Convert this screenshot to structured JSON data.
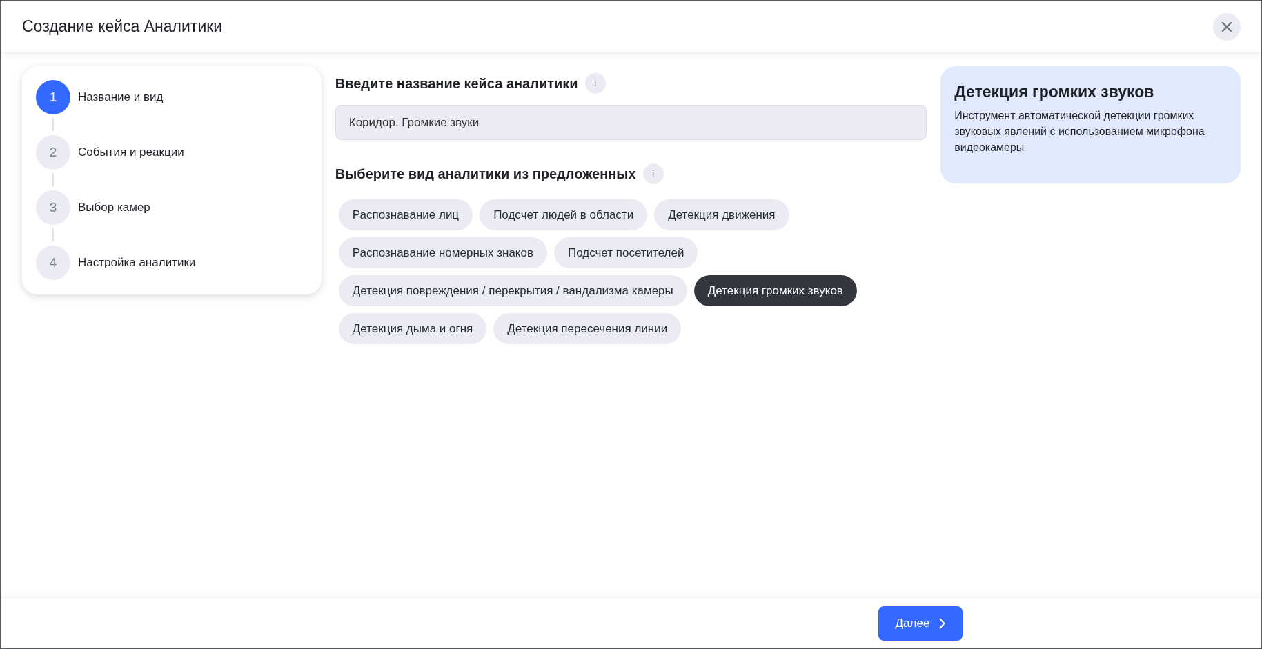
{
  "window": {
    "title": "Создание кейса Аналитики"
  },
  "steps": [
    {
      "number": "1",
      "label": "Название и вид",
      "selected": true
    },
    {
      "number": "2",
      "label": "События и реакции",
      "selected": false
    },
    {
      "number": "3",
      "label": "Выбор камер",
      "selected": false
    },
    {
      "number": "4",
      "label": "Настройка аналитики",
      "selected": false
    }
  ],
  "name_section": {
    "heading": "Введите название кейса аналитики",
    "info": "i",
    "value": "Коридор. Громкие звуки"
  },
  "type_section": {
    "heading": "Выберите вид аналитики из предложенных",
    "info": "i"
  },
  "analytics_types": [
    {
      "label": "Распознавание лиц",
      "selected": false
    },
    {
      "label": "Подсчет людей в области",
      "selected": false
    },
    {
      "label": "Детекция движения",
      "selected": false
    },
    {
      "label": "Распознавание номерных знаков",
      "selected": false
    },
    {
      "label": "Подсчет посетителей",
      "selected": false
    },
    {
      "label": "Детекция повреждения / перекрытия / вандализма камеры",
      "selected": false
    },
    {
      "label": "Детекция громких звуков",
      "selected": true
    },
    {
      "label": "Детекция дыма и огня",
      "selected": false
    },
    {
      "label": "Детекция пересечения линии",
      "selected": false
    }
  ],
  "description": {
    "title": "Детекция громких звуков",
    "text": "Инструмент автоматической детекции громких звуковых явлений с использованием микрофона видеокамеры"
  },
  "footer": {
    "next_button": "Далее"
  }
}
